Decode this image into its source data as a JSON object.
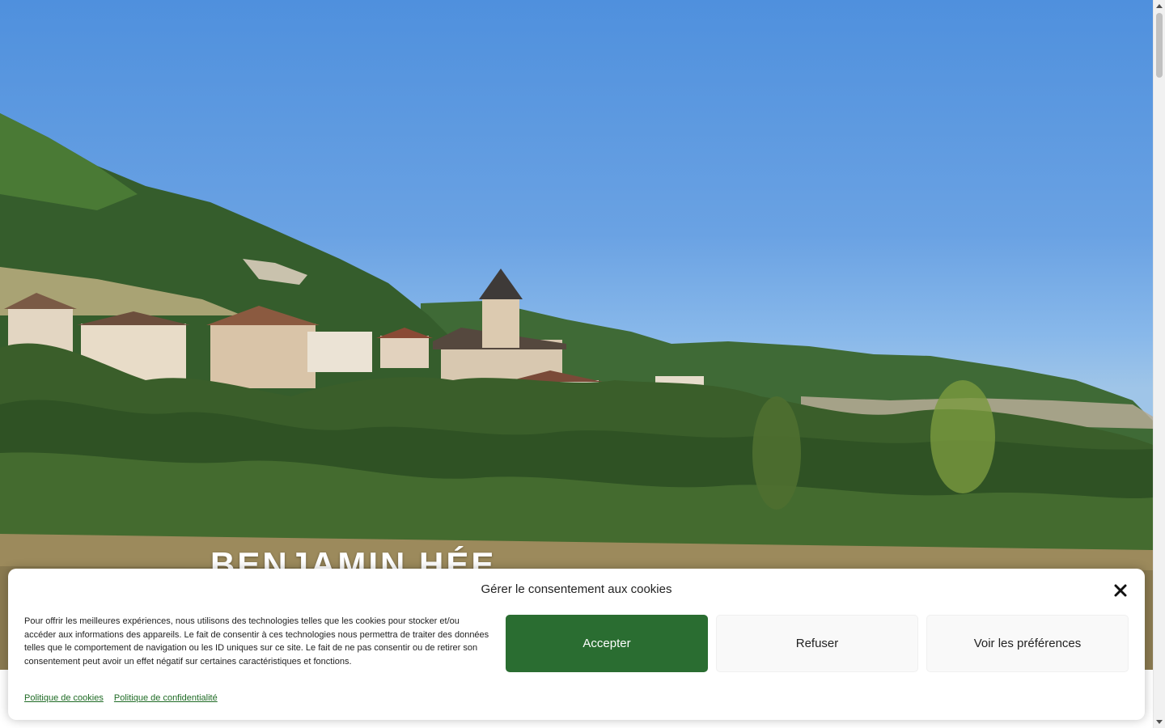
{
  "hero": {
    "site_title": "BENJAMIN HÉE"
  },
  "cookie_banner": {
    "title": "Gérer le consentement aux cookies",
    "body": "Pour offrir les meilleures expériences, nous utilisons des technologies telles que les cookies pour stocker et/ou accéder aux informations des appareils. Le fait de consentir à ces technologies nous permettra de traiter des données telles que le comportement de navigation ou les ID uniques sur ce site. Le fait de ne pas consentir ou de retirer son consentement peut avoir un effet négatif sur certaines caractéristiques et fonctions.",
    "accept_label": "Accepter",
    "refuse_label": "Refuser",
    "preferences_label": "Voir les préférences",
    "cookie_policy_link": "Politique de cookies",
    "privacy_policy_link": "Politique de confidentialité",
    "close_icon": "close-icon"
  },
  "colors": {
    "accept_button": "#2a6d31",
    "link": "#1f6b25",
    "sky": "#6aa2e3"
  }
}
